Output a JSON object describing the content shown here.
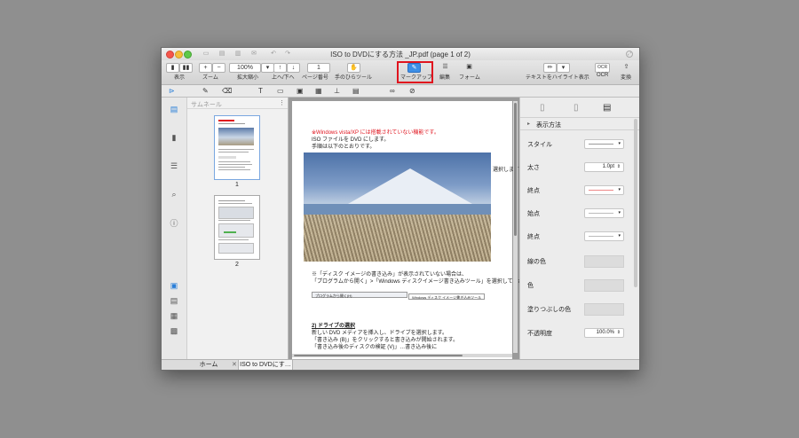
{
  "window": {
    "title": "ISO to DVDにする方法 _JP.pdf (page 1 of 2)"
  },
  "toolbar": {
    "view_label": "表示",
    "zoom_minus": "−",
    "zoom_plus": "+",
    "zoom_label": "ズーム",
    "zoom_value": "100%",
    "zoom_value_label": "拡大縮小",
    "updown_label": "上へ/下へ",
    "page_value": "1",
    "page_label": "ページ番号",
    "hand_label": "手のひらツール",
    "markup_label": "マークアップ",
    "edit_label": "編集",
    "form_label": "フォーム",
    "highlight_label": "テキストをハイライト表示",
    "ocr_icon": "OCR",
    "ocr_label": "OCR",
    "convert_label": "変換",
    "markup_accent": "#3d8fe6",
    "highlight_box_color": "#e0141e"
  },
  "sidebar": {
    "thumbnails_title": "サムネール",
    "pages": [
      {
        "label": "1"
      },
      {
        "label": "2"
      }
    ]
  },
  "document": {
    "warning": "※Windows vista/XP には搭載されていない機能です。",
    "line1": "ISO ファイルを DVD にします。",
    "line2": "手順は以下のとおりです。",
    "side_text": "選択します",
    "note1": "※「ディスク イメージの書き込み」が表示されていない場合は、",
    "note2": "「プログラムから開く」>「Windows ディスクイメージ書き込みツール」を選択してください。",
    "menu_item1": "プログラムから開く(H)",
    "menu_item2": "Windows ディスク イメージ書き込みツール",
    "section_heading": "2) ドライブの選択",
    "body1": "新しい DVD メディアを挿入し、ドライブを選択します。",
    "body2": "「書き込み (B)」をクリックすると書き込みが開始されます。",
    "body3": "「書き込み後のディスクの検証 (V)」…書き込み後に"
  },
  "inspector": {
    "section_title": "表示方法",
    "style_label": "スタイル",
    "width_label": "太さ",
    "width_value": "1.0pt",
    "endpoint_label": "終点",
    "startpoint_label": "始点",
    "endpoint2_label": "終点",
    "line_color_label": "線の色",
    "color_label": "色",
    "fill_color_label": "塗りつぶしの色",
    "opacity_label": "不透明度",
    "opacity_value": "100.0%"
  },
  "statusbar": {
    "home_tab": "ホーム",
    "doc_tab": "ISO to DVDにす…"
  }
}
